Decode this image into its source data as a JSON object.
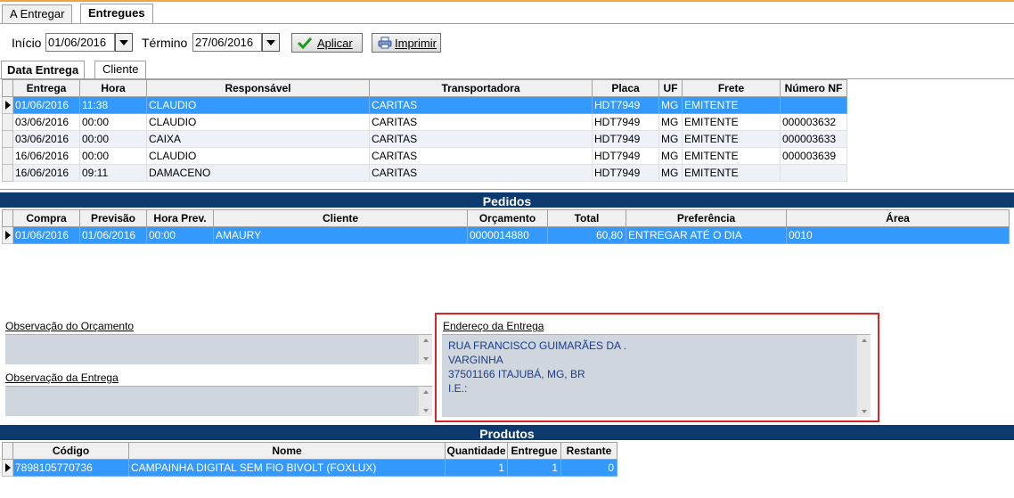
{
  "tabs": {
    "a_entregar": "A Entregar",
    "entregues": "Entregues"
  },
  "filter": {
    "inicio_label": "Início",
    "inicio_value": "01/06/2016",
    "termino_label": "Término",
    "termino_value": "27/06/2016",
    "aplicar_label": "Aplicar",
    "imprimir_label": "Imprimir"
  },
  "subtabs": {
    "data_entrega": "Data Entrega",
    "cliente": "Cliente"
  },
  "entregas": {
    "columns": [
      "Entrega",
      "Hora",
      "Responsável",
      "Transportadora",
      "Placa",
      "UF",
      "Frete",
      "Número NF"
    ],
    "rows": [
      [
        "01/06/2016",
        "11:38",
        "CLAUDIO",
        "CARITAS",
        "HDT7949",
        "MG",
        "EMITENTE",
        ""
      ],
      [
        "03/06/2016",
        "00:00",
        "CLAUDIO",
        "CARITAS",
        "HDT7949",
        "MG",
        "EMITENTE",
        "000003632"
      ],
      [
        "03/06/2016",
        "00:00",
        "CAIXA",
        "CARITAS",
        "HDT7949",
        "MG",
        "EMITENTE",
        "000003633"
      ],
      [
        "16/06/2016",
        "00:00",
        "CLAUDIO",
        "CARITAS",
        "HDT7949",
        "MG",
        "EMITENTE",
        "000003639"
      ],
      [
        "16/06/2016",
        "09:11",
        "DAMACENO",
        "CARITAS",
        "HDT7949",
        "MG",
        "EMITENTE",
        ""
      ]
    ]
  },
  "pedidos": {
    "title": "Pedidos",
    "columns": [
      "Compra",
      "Previsão",
      "Hora Prev.",
      "Cliente",
      "Orçamento",
      "Total",
      "Preferência",
      "Área"
    ],
    "rows": [
      [
        "01/06/2016",
        "01/06/2016",
        "00:00",
        "AMAURY",
        "0000014880",
        "60,80",
        "ENTREGAR ATÉ O DIA",
        "0010"
      ]
    ]
  },
  "obs_orcamento_label": "Observação do Orçamento",
  "obs_entrega_label": "Observação da Entrega",
  "endereco": {
    "label": "Endereço da Entrega",
    "line1": "RUA FRANCISCO GUIMARÃES DA .",
    "line2": "VARGINHA",
    "line3": "37501166 ITAJUBÁ, MG, BR",
    "line4": "I.E.:"
  },
  "produtos": {
    "title": "Produtos",
    "columns": [
      "Código",
      "Nome",
      "Quantidade",
      "Entregue",
      "Restante"
    ],
    "rows": [
      [
        "7898105770736",
        "CAMPAINHA DIGITAL SEM FIO BIVOLT (FOXLUX)",
        "1",
        "1",
        "0"
      ]
    ]
  },
  "colors": {
    "selection": "#3399ff",
    "section_header": "#0c3a6e",
    "highlight_box": "#d9252a",
    "accent_line": "#f4a340"
  }
}
